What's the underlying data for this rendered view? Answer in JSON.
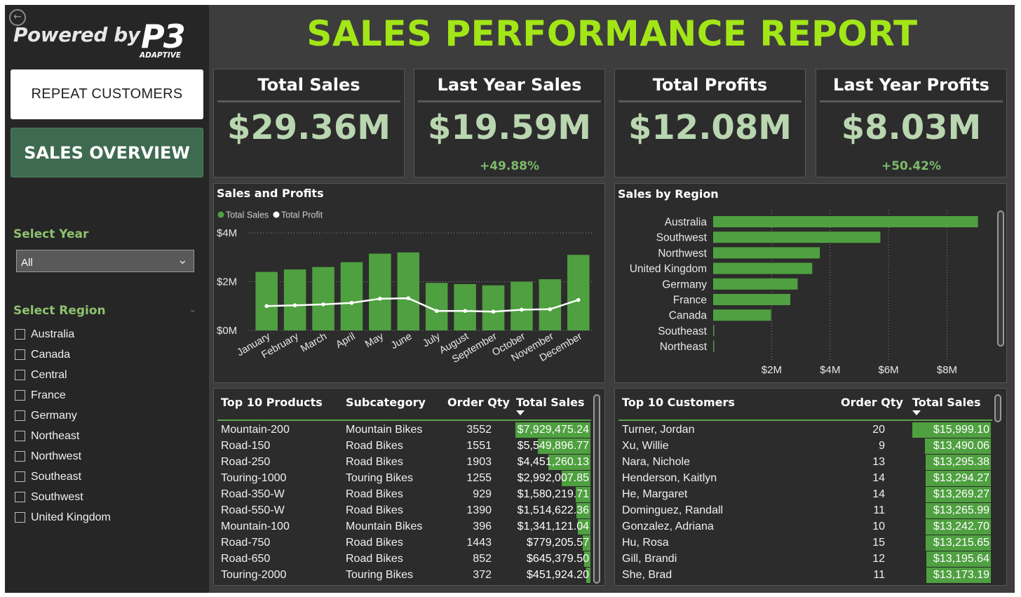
{
  "nav": {
    "back_icon": "back-arrow-icon",
    "logo_powered": "Powered by",
    "logo_brand": "P3",
    "logo_sub": "ADAPTIVE",
    "repeat_customers": "REPEAT CUSTOMERS",
    "sales_overview": "SALES OVERVIEW"
  },
  "filters": {
    "year_title": "Select Year",
    "year_value": "All",
    "region_title": "Select Region",
    "regions": [
      "Australia",
      "Canada",
      "Central",
      "France",
      "Germany",
      "Northeast",
      "Northwest",
      "Southeast",
      "Southwest",
      "United Kingdom"
    ]
  },
  "report_title": "SALES PERFORMANCE REPORT",
  "kpis": [
    {
      "title": "Total Sales",
      "value": "$29.36M",
      "change": ""
    },
    {
      "title": "Last Year Sales",
      "value": "$19.59M",
      "change": "+49.88%"
    },
    {
      "title": "Total Profits",
      "value": "$12.08M",
      "change": ""
    },
    {
      "title": "Last Year Profits",
      "value": "$8.03M",
      "change": "+50.42%"
    }
  ],
  "colors": {
    "accent_title": "#a3e617",
    "bar_green": "#4fa040",
    "kpi_value": "#b9d6b0",
    "change_green": "#7dbb6a"
  },
  "chart_data": [
    {
      "type": "bar",
      "title": "Sales and Profits",
      "categories": [
        "January",
        "February",
        "March",
        "April",
        "May",
        "June",
        "July",
        "August",
        "September",
        "October",
        "November",
        "December"
      ],
      "series": [
        {
          "name": "Total Sales",
          "kind": "bar",
          "color": "#4fa040",
          "values": [
            2.4,
            2.5,
            2.6,
            2.8,
            3.15,
            3.2,
            1.95,
            1.9,
            1.85,
            2.0,
            2.1,
            3.1
          ]
        },
        {
          "name": "Total Profit",
          "kind": "line",
          "color": "#ffffff",
          "values": [
            1.0,
            1.03,
            1.07,
            1.13,
            1.3,
            1.32,
            0.8,
            0.8,
            0.77,
            0.85,
            0.87,
            1.25
          ]
        }
      ],
      "y_ticks": [
        "$0M",
        "$2M",
        "$4M"
      ],
      "ylim": [
        0,
        4
      ],
      "legend": "top-left",
      "grid": true
    },
    {
      "type": "bar",
      "orientation": "horizontal",
      "title": "Sales by Region",
      "categories": [
        "Australia",
        "Southwest",
        "Northwest",
        "United Kingdom",
        "Germany",
        "France",
        "Canada",
        "Southeast",
        "Northeast"
      ],
      "values": [
        9.06,
        5.72,
        3.65,
        3.39,
        2.89,
        2.64,
        1.98,
        0.01,
        0.01
      ],
      "x_ticks": [
        "$2M",
        "$4M",
        "$6M",
        "$8M"
      ],
      "xlim": [
        0,
        9.5
      ],
      "grid": true
    }
  ],
  "products_table": {
    "headers": [
      "Top 10 Products",
      "Subcategory",
      "Order Qty",
      "Total Sales"
    ],
    "sort_icon": "sort-desc-icon",
    "rows": [
      {
        "product": "Mountain-200",
        "subcategory": "Mountain Bikes",
        "qty": "3552",
        "sales": "$7,929,475.24",
        "share": 1.0
      },
      {
        "product": "Road-150",
        "subcategory": "Road Bikes",
        "qty": "1551",
        "sales": "$5,549,896.77",
        "share": 0.7
      },
      {
        "product": "Road-250",
        "subcategory": "Road Bikes",
        "qty": "1903",
        "sales": "$4,451,260.13",
        "share": 0.56
      },
      {
        "product": "Touring-1000",
        "subcategory": "Touring Bikes",
        "qty": "1255",
        "sales": "$2,992,007.85",
        "share": 0.38
      },
      {
        "product": "Road-350-W",
        "subcategory": "Road Bikes",
        "qty": "929",
        "sales": "$1,580,219.71",
        "share": 0.2
      },
      {
        "product": "Road-550-W",
        "subcategory": "Road Bikes",
        "qty": "1390",
        "sales": "$1,514,622.36",
        "share": 0.19
      },
      {
        "product": "Mountain-100",
        "subcategory": "Mountain Bikes",
        "qty": "396",
        "sales": "$1,341,121.04",
        "share": 0.17
      },
      {
        "product": "Road-750",
        "subcategory": "Road Bikes",
        "qty": "1443",
        "sales": "$779,205.57",
        "share": 0.1
      },
      {
        "product": "Road-650",
        "subcategory": "Road Bikes",
        "qty": "852",
        "sales": "$645,379.50",
        "share": 0.08
      },
      {
        "product": "Touring-2000",
        "subcategory": "Touring Bikes",
        "qty": "372",
        "sales": "$451,924.20",
        "share": 0.06
      }
    ]
  },
  "customers_table": {
    "headers": [
      "Top 10 Customers",
      "Order Qty",
      "Total Sales"
    ],
    "sort_icon": "sort-desc-icon",
    "rows": [
      {
        "customer": "Turner, Jordan",
        "qty": "20",
        "sales": "$15,999.10",
        "share": 1.0
      },
      {
        "customer": "Xu, Willie",
        "qty": "9",
        "sales": "$13,490.06",
        "share": 0.84
      },
      {
        "customer": "Nara, Nichole",
        "qty": "13",
        "sales": "$13,295.38",
        "share": 0.83
      },
      {
        "customer": "Henderson, Kaitlyn",
        "qty": "14",
        "sales": "$13,294.27",
        "share": 0.83
      },
      {
        "customer": "He, Margaret",
        "qty": "14",
        "sales": "$13,269.27",
        "share": 0.83
      },
      {
        "customer": "Dominguez, Randall",
        "qty": "11",
        "sales": "$13,265.99",
        "share": 0.83
      },
      {
        "customer": "Gonzalez, Adriana",
        "qty": "10",
        "sales": "$13,242.70",
        "share": 0.83
      },
      {
        "customer": "Hu, Rosa",
        "qty": "15",
        "sales": "$13,215.65",
        "share": 0.83
      },
      {
        "customer": "Gill, Brandi",
        "qty": "12",
        "sales": "$13,195.64",
        "share": 0.82
      },
      {
        "customer": "She, Brad",
        "qty": "11",
        "sales": "$13,173.19",
        "share": 0.82
      }
    ]
  }
}
